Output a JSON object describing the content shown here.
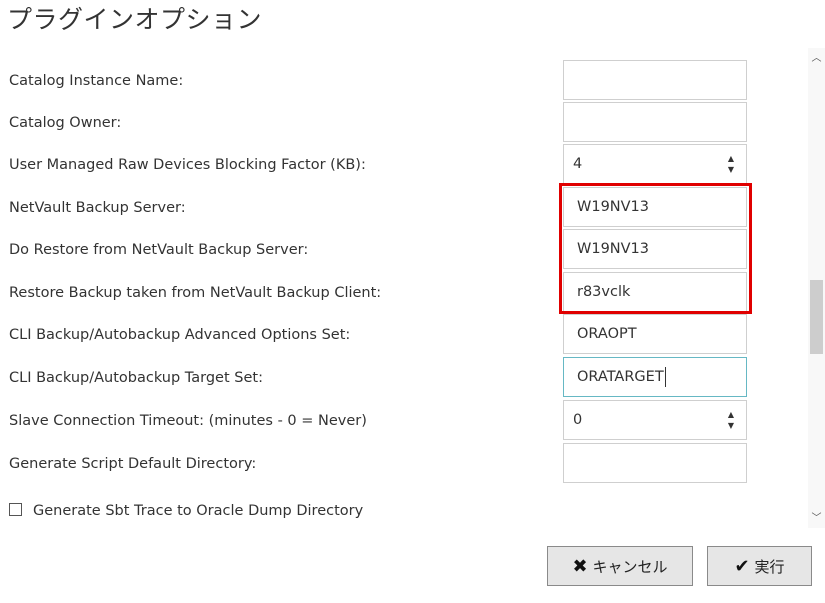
{
  "dialog": {
    "title": "プラグインオプション"
  },
  "fields": [
    {
      "label": "Catalog Instance Name:",
      "value": ""
    },
    {
      "label": "Catalog Owner:",
      "value": ""
    },
    {
      "label": "User Managed Raw Devices Blocking Factor (KB):",
      "value": "4"
    },
    {
      "label": "NetVault Backup Server:",
      "value": "W19NV13"
    },
    {
      "label": "Do Restore from NetVault Backup Server:",
      "value": "W19NV13"
    },
    {
      "label": "Restore Backup taken from NetVault Backup Client:",
      "value": "r83vclk"
    },
    {
      "label": "CLI Backup/Autobackup Advanced Options Set:",
      "value": "ORAOPT"
    },
    {
      "label": "CLI Backup/Autobackup Target Set:",
      "value": "ORATARGET"
    },
    {
      "label": "Slave Connection Timeout: (minutes - 0 = Never)",
      "value": "0"
    },
    {
      "label": "Generate Script Default Directory:",
      "value": ""
    }
  ],
  "checkbox": {
    "label": "Generate Sbt Trace to Oracle Dump Directory",
    "checked": false
  },
  "buttons": {
    "cancel_label": "キャンセル",
    "run_label": "実行"
  },
  "icons": {
    "cancel": "x-icon",
    "run": "check-icon"
  },
  "colors": {
    "highlight": "#e00000",
    "focus_border": "#66b8c4",
    "button_bg": "#e6e6e6"
  }
}
